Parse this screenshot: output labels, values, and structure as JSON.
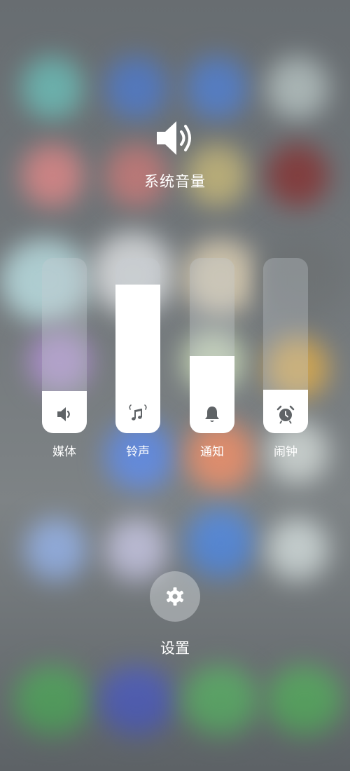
{
  "panel": {
    "title": "系统音量",
    "header_icon": "speaker-icon"
  },
  "sliders": [
    {
      "id": "media",
      "label": "媒体",
      "icon": "speaker-icon",
      "level": 0.24
    },
    {
      "id": "ringtone",
      "label": "铃声",
      "icon": "music-note-icon",
      "level": 0.85
    },
    {
      "id": "notification",
      "label": "通知",
      "icon": "bell-icon",
      "level": 0.44
    },
    {
      "id": "alarm",
      "label": "闹钟",
      "icon": "alarm-clock-icon",
      "level": 0.25
    }
  ],
  "settings": {
    "label": "设置",
    "icon": "gear-icon"
  },
  "colors": {
    "fill": "#ffffff",
    "track": "rgba(200,206,210,0.32)",
    "icon": "#5f6366",
    "text": "#ffffff"
  }
}
